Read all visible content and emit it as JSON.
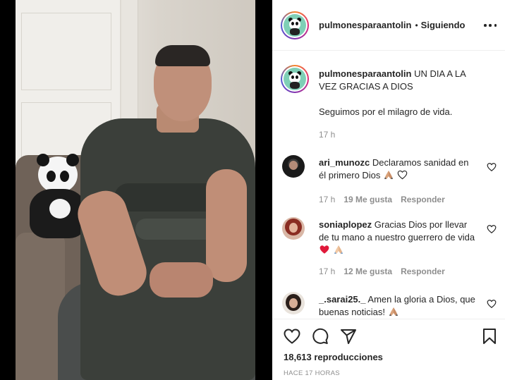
{
  "post": {
    "username": "pulmonesparaantolin",
    "follow_status": "Siguiendo",
    "separator": "•",
    "caption_line1": "UN DIA A LA VEZ GRACIAS A DIOS",
    "caption_line2": "Seguimos por el milagro de vida.",
    "caption_time": "17 h"
  },
  "comments": [
    {
      "username": "ari_munozc",
      "text": "Declaramos sanidad en él primero Dios",
      "time": "17 h",
      "likes": "19 Me gusta",
      "reply": "Responder"
    },
    {
      "username": "soniaplopez",
      "text": "Gracias Dios por llevar de tu mano a nuestro guerrero de vida",
      "time": "17 h",
      "likes": "12 Me gusta",
      "reply": "Responder"
    },
    {
      "username": "_.sarai25._",
      "text": "Amen la gloria a Dios, que buenas noticias!",
      "time": "",
      "likes": "",
      "reply": ""
    }
  ],
  "footer": {
    "views": "18,613 reproducciones",
    "time_ago": "HACE 17 HORAS"
  },
  "icons": {
    "like": "heart-outline-icon",
    "comment": "comment-bubble-icon",
    "share": "paper-plane-icon",
    "save": "bookmark-icon",
    "more": "more-options-icon"
  },
  "colors": {
    "text": "#262626",
    "secondary": "#8e8e8e",
    "heart_red": "#ed4956"
  }
}
